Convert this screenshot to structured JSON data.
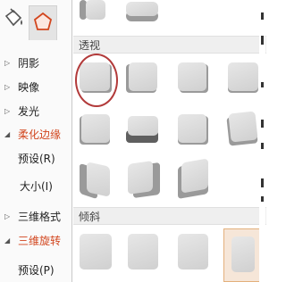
{
  "pane": {
    "tabs": [
      {
        "name": "fill-line-tab"
      },
      {
        "name": "effects-tab",
        "active": true
      }
    ],
    "items": [
      {
        "arrow": "▷",
        "label": "阴影",
        "color": "#222222"
      },
      {
        "arrow": "▷",
        "label": "映像",
        "color": "#222222"
      },
      {
        "arrow": "▷",
        "label": "发光",
        "color": "#222222"
      },
      {
        "arrow": "◢",
        "label": "柔化边缘",
        "color": "#d2461e"
      },
      {
        "arrow": "",
        "label": "预设(R)",
        "color": "#222222"
      },
      {
        "arrow": "",
        "label": "大小(I)",
        "color": "#222222"
      },
      {
        "arrow": "▷",
        "label": "三维格式",
        "color": "#222222"
      },
      {
        "arrow": "◢",
        "label": "三维旋转",
        "color": "#d2461e"
      },
      {
        "arrow": "",
        "label": "预设(P)",
        "color": "#222222"
      }
    ]
  },
  "gallery": {
    "sections": [
      {
        "title": "透视"
      },
      {
        "title": "倾斜"
      }
    ]
  },
  "colors": {
    "accent_orange": "#d2461e",
    "highlight_ring": "#b23a3a",
    "selected_fill": "#f6e6d8",
    "selected_border": "#e3b07c"
  }
}
